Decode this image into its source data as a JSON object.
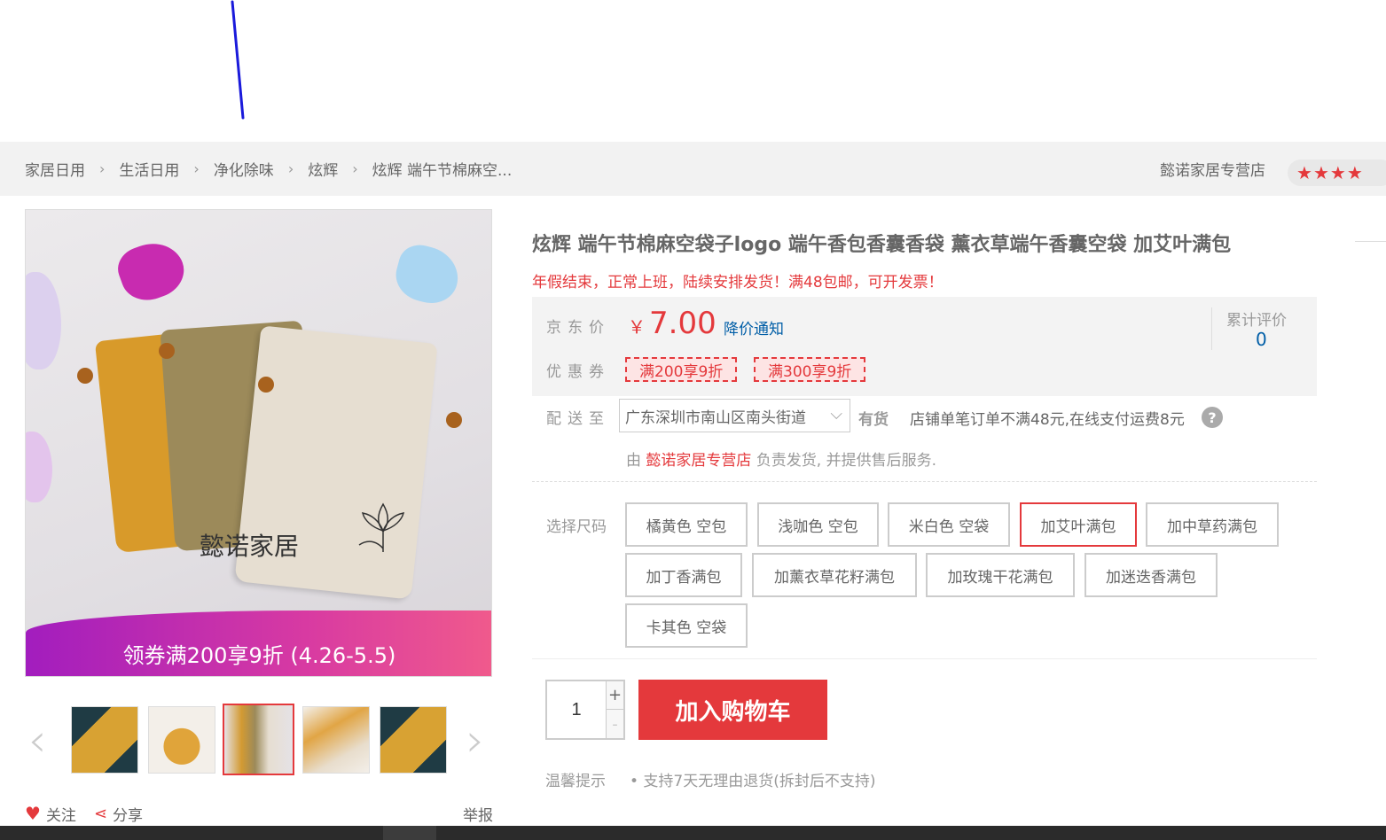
{
  "breadcrumb": {
    "items": [
      "家居日用",
      "生活日用",
      "净化除味",
      "炫辉",
      "炫辉 端午节棉麻空..."
    ]
  },
  "shop": {
    "name": "懿诺家居专营店",
    "rating_stars": 3.5
  },
  "gallery": {
    "brand_mark": "懿诺家居",
    "promo_text": "领券满200享9折 (4.26-5.5)",
    "active_thumb_index": 2,
    "thumb_count": 5
  },
  "actions": {
    "follow": "关注",
    "share": "分享",
    "report": "举报"
  },
  "product": {
    "title": "炫辉 端午节棉麻空袋子logo 端午香包香囊香袋 薰衣草端午香囊空袋 加艾叶满包",
    "notice": "年假结束，正常上班，陆续安排发货！满48包邮，可开发票！"
  },
  "price": {
    "label": "京东价",
    "currency": "￥",
    "value": "7.00",
    "alert": "降价通知"
  },
  "reviews": {
    "label": "累计评价",
    "count": "0"
  },
  "coupons": {
    "label": "优惠券",
    "items": [
      "满200享9折",
      "满300享9折"
    ]
  },
  "delivery": {
    "label": "配送至",
    "address": "广东深圳市南山区南头街道",
    "stock": "有货",
    "fee_note": "店铺单笔订单不满48元,在线支付运费8元",
    "help_icon": "?",
    "seller_prefix": "由",
    "seller_shop": "懿诺家居专营店",
    "seller_suffix": "负责发货, 并提供售后服务."
  },
  "sizes": {
    "label": "选择尺码",
    "options": [
      "橘黄色 空包",
      "浅咖色 空包",
      "米白色 空袋",
      "加艾叶满包",
      "加中草药满包",
      "加丁香满包",
      "加薰衣草花籽满包",
      "加玫瑰干花满包",
      "加迷迭香满包",
      "卡其色 空袋"
    ],
    "selected": "加艾叶满包"
  },
  "purchase": {
    "quantity": "1",
    "plus": "+",
    "minus": "-",
    "add_to_cart": "加入购物车"
  },
  "tips": {
    "label": "温馨提示",
    "text": "• 支持7天无理由退货(拆封后不支持)"
  },
  "colors": {
    "accent": "#e4393c",
    "link": "#005ea7"
  }
}
